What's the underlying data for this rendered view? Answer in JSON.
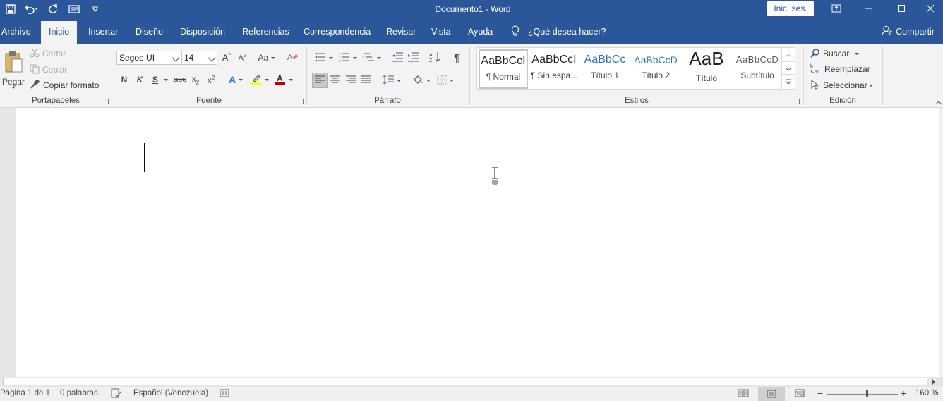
{
  "window": {
    "title": "Documento1 - Word",
    "sign_in": "Inic. ses."
  },
  "tabs": [
    "Archivo",
    "Inicio",
    "Insertar",
    "Diseño",
    "Disposición",
    "Referencias",
    "Correspondencia",
    "Revisar",
    "Vista",
    "Ayuda"
  ],
  "active_tab": "Inicio",
  "tell_me": "¿Qué desea hacer?",
  "share": "Compartir",
  "clipboard": {
    "label": "Portapapeles",
    "paste": "Pegar",
    "cut": "Cortar",
    "copy": "Copiar",
    "format_painter": "Copiar formato"
  },
  "font": {
    "label": "Fuente",
    "name": "Segoe UI",
    "size": "14",
    "bold": "N",
    "italic": "K",
    "underline": "S",
    "strike": "abc",
    "change_case": "Aa"
  },
  "paragraph": {
    "label": "Párrafo"
  },
  "styles": {
    "label": "Estilos",
    "items": [
      {
        "preview": "AaBbCcI",
        "name": "¶ Normal"
      },
      {
        "preview": "AaBbCcI",
        "name": "¶ Sin espa..."
      },
      {
        "preview": "AaBbCc",
        "name": "Título 1"
      },
      {
        "preview": "AaBbCcD",
        "name": "Título 2"
      },
      {
        "preview": "AaB",
        "name": "Título"
      },
      {
        "preview": "AaBbCcD",
        "name": "Subtítulo"
      }
    ]
  },
  "editing": {
    "label": "Edición",
    "find": "Buscar",
    "replace": "Reemplazar",
    "select": "Seleccionar"
  },
  "status": {
    "page": "Página 1 de 1",
    "words": "0 palabras",
    "language": "Español (Venezuela)",
    "zoom": "160 %",
    "zoom_minus": "−",
    "zoom_plus": "+"
  },
  "colors": {
    "brand": "#2b579a",
    "ribbon": "#f3f3f3",
    "highlight": "#ffff00",
    "font_color": "#c00000"
  }
}
